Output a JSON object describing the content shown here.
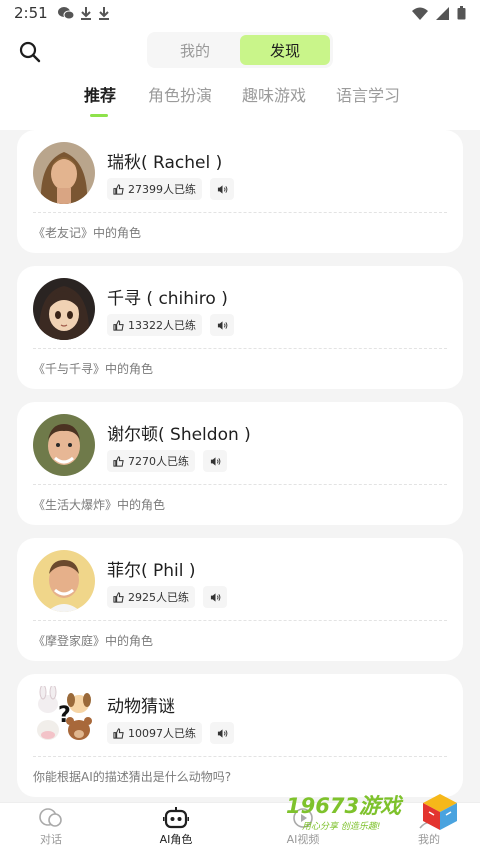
{
  "status_bar": {
    "time": "2:51"
  },
  "header": {
    "segments": [
      {
        "label": "我的",
        "active": false
      },
      {
        "label": "发现",
        "active": true
      }
    ]
  },
  "tabs": [
    {
      "label": "推荐",
      "active": true
    },
    {
      "label": "角色扮演",
      "active": false
    },
    {
      "label": "趣味游戏",
      "active": false
    },
    {
      "label": "语言学习",
      "active": false
    }
  ],
  "cards": [
    {
      "name": "瑞秋( Rachel )",
      "practice": "27399人已练",
      "desc": "《老友记》中的角色",
      "avatar": "rachel-avatar"
    },
    {
      "name": "千寻 ( chihiro )",
      "practice": "13322人已练",
      "desc": "《千与千寻》中的角色",
      "avatar": "chihiro-avatar"
    },
    {
      "name": "谢尔顿( Sheldon )",
      "practice": "7270人已练",
      "desc": "《生活大爆炸》中的角色",
      "avatar": "sheldon-avatar"
    },
    {
      "name": "菲尔( Phil )",
      "practice": "2925人已练",
      "desc": "《摩登家庭》中的角色",
      "avatar": "phil-avatar"
    },
    {
      "name": "动物猜谜",
      "practice": "10097人已练",
      "desc": "你能根据AI的描述猜出是什么动物吗?",
      "avatar": "animal-quiz-avatar"
    }
  ],
  "bottom_nav": [
    {
      "label": "对话",
      "icon": "chat-bubbles-icon",
      "active": false
    },
    {
      "label": "AI角色",
      "icon": "robot-icon",
      "active": true
    },
    {
      "label": "AI视频",
      "icon": "video-icon",
      "active": false
    },
    {
      "label": "我的",
      "icon": "profile-icon",
      "active": false
    }
  ],
  "watermark": {
    "title": "19673游戏",
    "subtitle": "用心分享  创造乐趣!"
  },
  "colors": {
    "accent": "#8ee24b",
    "segment_active": "#c9f58a",
    "background": "#f4f4f4",
    "watermark": "#7ec22c"
  }
}
